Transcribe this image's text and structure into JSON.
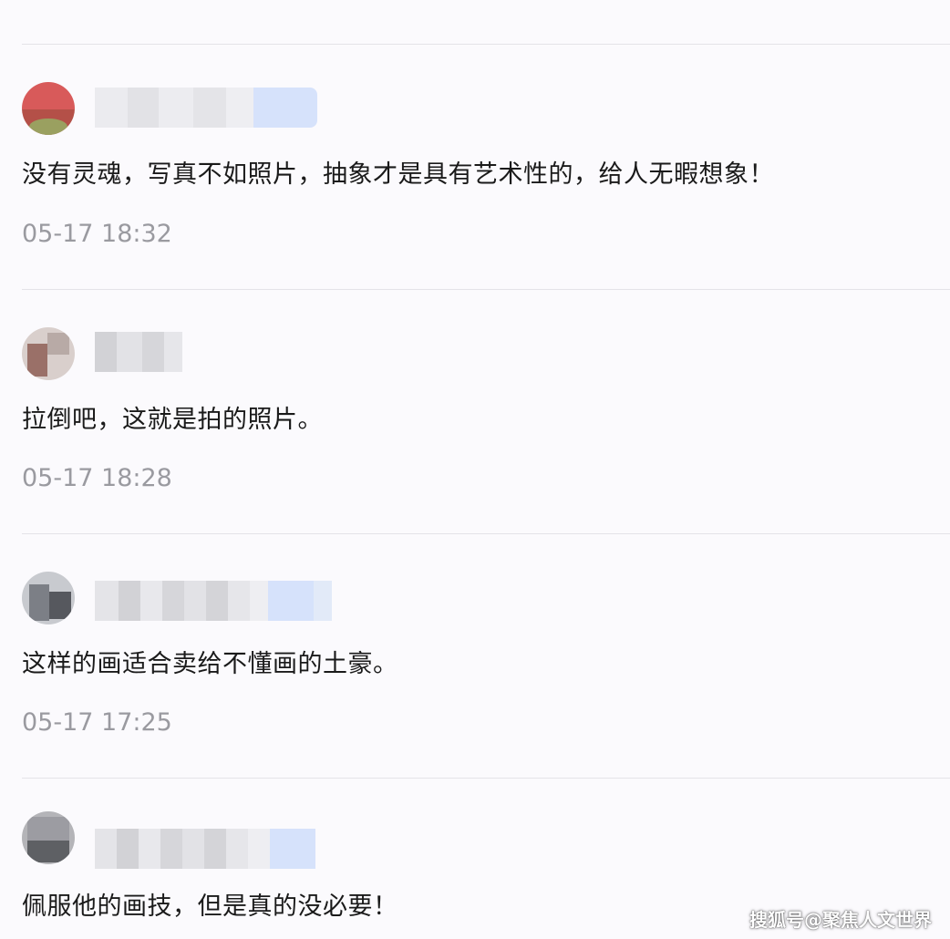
{
  "comments": [
    {
      "text": "没有灵魂，写真不如照片，抽象才是具有艺术性的，给人无暇想象！",
      "time": "05-17 18:32"
    },
    {
      "text": "拉倒吧，这就是拍的照片。",
      "time": "05-17 18:28"
    },
    {
      "text": "这样的画适合卖给不懂画的土豪。",
      "time": "05-17 17:25"
    },
    {
      "text": "佩服他的画技，但是真的没必要！",
      "time": ""
    }
  ],
  "watermark": "搜狐号@聚焦人文世界",
  "colors": {
    "background": "#fbfafd",
    "divider": "#e4e3e8",
    "time_text": "#9a9aa0",
    "comment_text": "#1a1a1a",
    "name_blur_accent": "#d6e2fb"
  }
}
